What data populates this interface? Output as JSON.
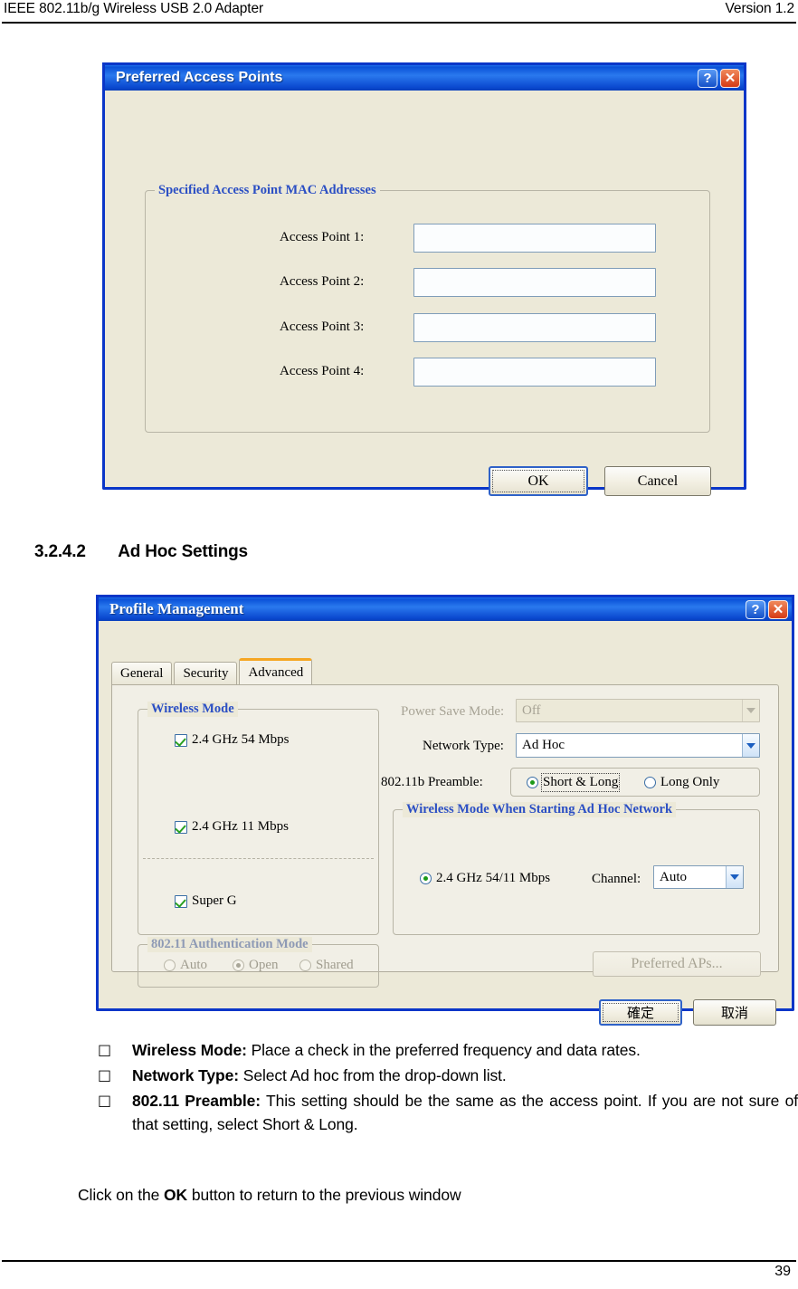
{
  "page": {
    "header_left": "IEEE 802.11b/g Wireless USB 2.0 Adapter",
    "header_right": "Version 1.2",
    "number": "39"
  },
  "dialog_preferred_aps": {
    "title": "Preferred Access Points",
    "help_label": "?",
    "close_label": "✕",
    "group_title": "Specified Access Point MAC Addresses",
    "fields": [
      {
        "label": "Access Point 1:",
        "value": "",
        "placeholder": ""
      },
      {
        "label": "Access Point 2:",
        "value": "",
        "placeholder": ""
      },
      {
        "label": "Access Point 3:",
        "value": "",
        "placeholder": ""
      },
      {
        "label": "Access Point 4:",
        "value": "",
        "placeholder": ""
      }
    ],
    "ok_label": "OK",
    "cancel_label": "Cancel"
  },
  "section": {
    "number": "3.2.4.2",
    "title": "Ad Hoc Settings"
  },
  "dialog_profile_management": {
    "title": "Profile Management",
    "help_label": "?",
    "close_label": "✕",
    "tabs": [
      {
        "label": "General",
        "active": false
      },
      {
        "label": "Security",
        "active": false
      },
      {
        "label": "Advanced",
        "active": true
      }
    ],
    "wireless_mode": {
      "group_title": "Wireless Mode",
      "items": [
        {
          "label": "2.4 GHz 54 Mbps",
          "checked": true
        },
        {
          "label": "2.4 GHz 11 Mbps",
          "checked": true
        },
        {
          "label": "Super G",
          "checked": true
        }
      ]
    },
    "auth_mode": {
      "group_title": "802.11 Authentication Mode",
      "disabled": true,
      "options": [
        {
          "label": "Auto",
          "selected": false
        },
        {
          "label": "Open",
          "selected": true
        },
        {
          "label": "Shared",
          "selected": false
        }
      ]
    },
    "power_save_mode": {
      "label": "Power Save Mode:",
      "value": "Off",
      "disabled": true
    },
    "network_type": {
      "label": "Network Type:",
      "value": "Ad Hoc",
      "disabled": false
    },
    "preamble": {
      "label": "802.11b Preamble:",
      "options": [
        {
          "label": "Short & Long",
          "selected": true,
          "focused": true
        },
        {
          "label": "Long Only",
          "selected": false,
          "focused": false
        }
      ]
    },
    "adhoc_group": {
      "group_title": "Wireless Mode When Starting Ad Hoc Network",
      "rate_label": "2.4 GHz 54/11 Mbps",
      "rate_selected": true,
      "channel_label": "Channel:",
      "channel_value": "Auto"
    },
    "preferred_aps_label": "Preferred APs...",
    "preferred_aps_disabled": true,
    "ok_label": "確定",
    "cancel_label": "取消"
  },
  "body": {
    "bullet_glyph": "□",
    "bullets": [
      {
        "term": "Wireless Mode:",
        "text": " Place a check in the preferred frequency and data rates."
      },
      {
        "term": "Network Type:",
        "text": " Select Ad hoc from the drop-down list."
      },
      {
        "term": "802.11 Preamble:",
        "text": " This setting should be the same as the access point. If you are not sure of that setting, select Short & Long."
      }
    ],
    "closing": {
      "pre": "Click on the ",
      "bold": "OK",
      "post": " button to return to the previous window"
    }
  }
}
